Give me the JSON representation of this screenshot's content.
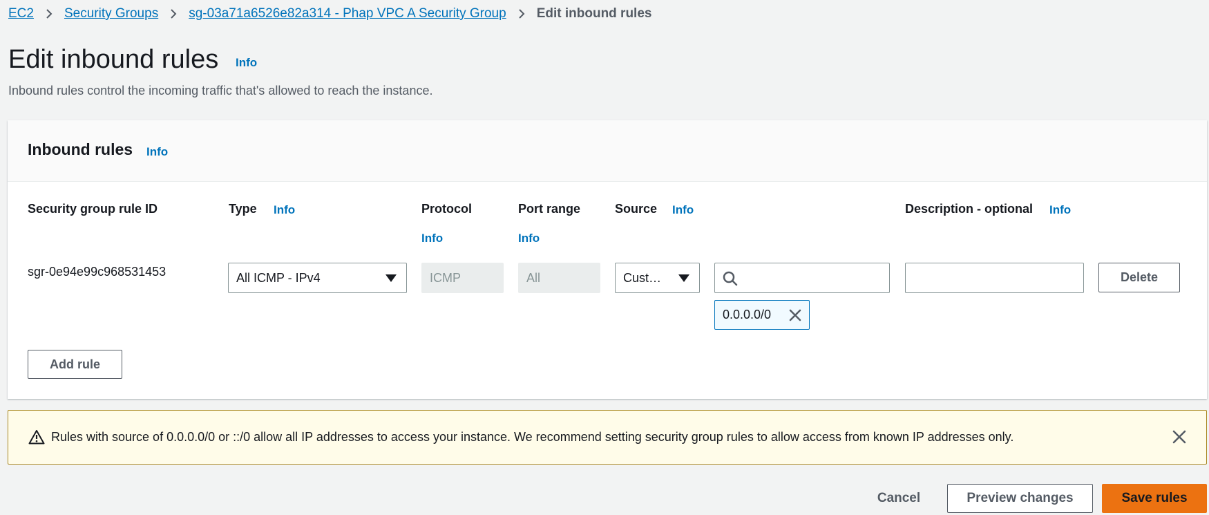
{
  "breadcrumb": {
    "items": [
      "EC2",
      "Security Groups",
      "sg-03a71a6526e82a314 - Phap VPC A Security Group"
    ],
    "current": "Edit inbound rules",
    "separator_icon": "chevron-right-icon"
  },
  "header": {
    "title": "Edit inbound rules",
    "info": "Info",
    "description": "Inbound rules control the incoming traffic that's allowed to reach the instance."
  },
  "panel": {
    "title": "Inbound rules",
    "info": "Info",
    "columns": {
      "rule_id": "Security group rule ID",
      "type": "Type",
      "protocol": "Protocol",
      "port_range": "Port range",
      "source": "Source",
      "description": "Description - optional"
    },
    "column_info": "Info",
    "rule": {
      "id": "sgr-0e94e99c968531453",
      "type": "All ICMP - IPv4",
      "protocol": "ICMP",
      "port_range": "All",
      "source_type": "Cust…",
      "source_search_value": "",
      "source_token": "0.0.0.0/0",
      "description_value": "",
      "delete_label": "Delete"
    },
    "add_rule_label": "Add rule"
  },
  "alert": {
    "text": "Rules with source of 0.0.0.0/0 or ::/0 allow all IP addresses to access your instance. We recommend setting security group rules to allow access from known IP addresses only.",
    "icon": "warning-icon",
    "color": "#a98720"
  },
  "footer": {
    "cancel_label": "Cancel",
    "preview_label": "Preview changes",
    "save_label": "Save rules"
  },
  "colors": {
    "link": "#0073bb",
    "primary": "#ec7211",
    "background": "#f2f3f3"
  }
}
